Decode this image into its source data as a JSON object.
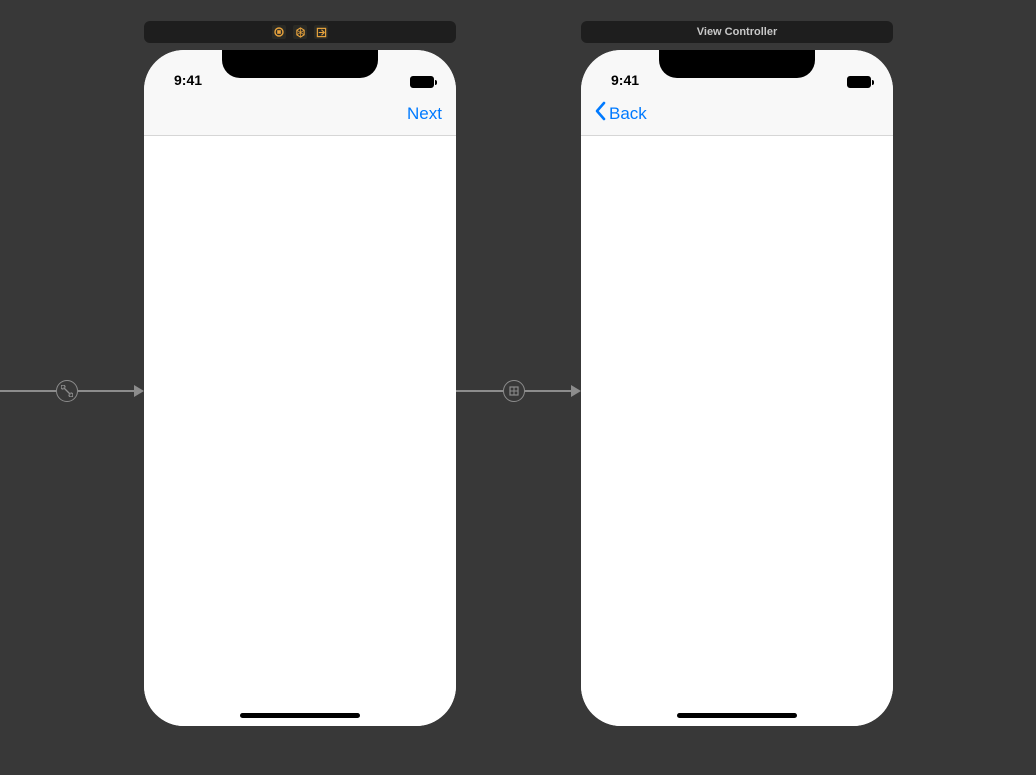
{
  "scene1": {
    "title_icons": [
      "nav-controller-icon",
      "first-responder-icon",
      "exit-icon"
    ],
    "status_time": "9:41",
    "nav_right_label": "Next"
  },
  "scene2": {
    "title_label": "View Controller",
    "status_time": "9:41",
    "nav_left_label": "Back"
  },
  "colors": {
    "tint": "#007aff",
    "ib_icon_orange": "#e8a33d"
  }
}
